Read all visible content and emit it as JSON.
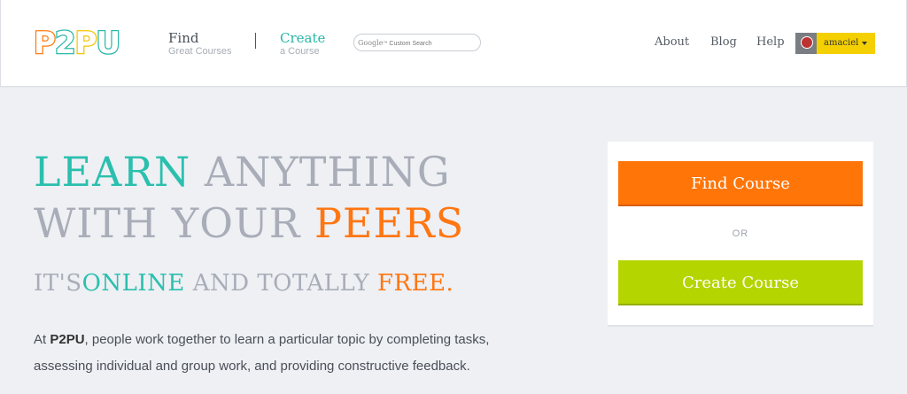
{
  "header": {
    "logo": {
      "letters": [
        "P",
        "2",
        "P",
        "U"
      ],
      "colors": [
        "#ff7a10",
        "#2bb8a8",
        "#f5c400",
        "#2bb8a8"
      ]
    },
    "find": {
      "main": "Find",
      "sub": "Great Courses"
    },
    "create": {
      "main": "Create",
      "sub": "a Course"
    },
    "search": {
      "brand": "Google",
      "placeholder": "Custom Search"
    },
    "menu": {
      "about": "About",
      "blog": "Blog",
      "help": "Help"
    },
    "user": {
      "name": "amaciel"
    }
  },
  "hero": {
    "line1": {
      "w1": "LEARN",
      "w2": "ANYTHING"
    },
    "line2": {
      "w1": "WITH YOUR",
      "w2": "PEERS"
    },
    "tagline": {
      "p1": "IT'S",
      "p2": "ONLINE",
      "p3": "AND TOTALLY",
      "p4": "FREE."
    },
    "desc": {
      "prefix": "At ",
      "brand": "P2PU",
      "text": ", people work together to learn a particular topic by completing tasks, assessing individual and group work, and providing constructive feedback."
    }
  },
  "card": {
    "find_label": "Find Course",
    "or_label": "OR",
    "create_label": "Create Course"
  },
  "colors": {
    "teal": "#2bbfae",
    "orange": "#ff7612",
    "grey": "#a8adb8",
    "green": "#b4d500",
    "yellow": "#f5d000"
  }
}
